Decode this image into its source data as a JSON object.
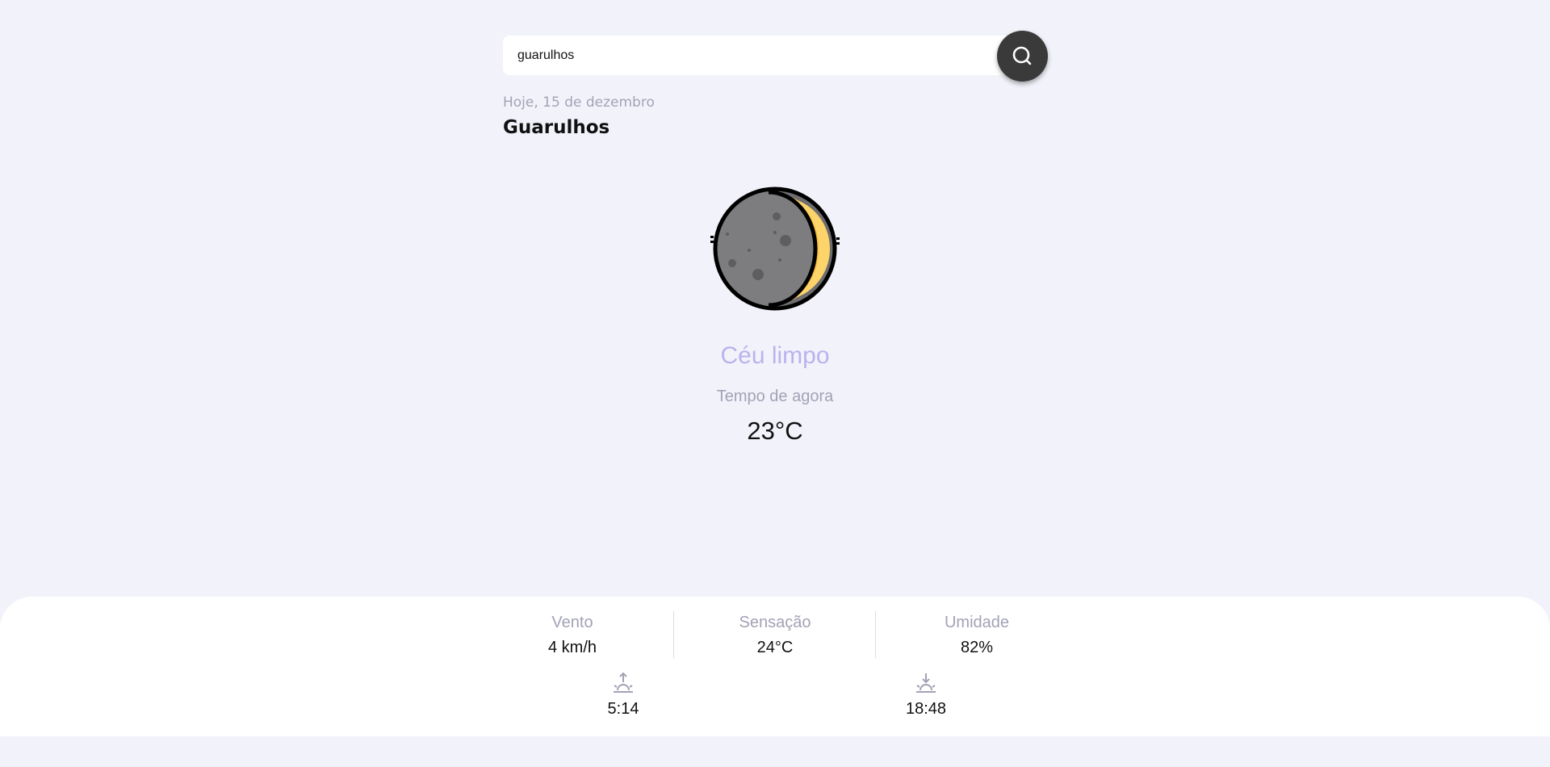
{
  "search": {
    "value": "guarulhos",
    "icon": "search-icon"
  },
  "location": {
    "date": "Hoje, 15 de dezembro",
    "city": "Guarulhos"
  },
  "current": {
    "icon": "crescent-moon-icon",
    "condition": "Céu limpo",
    "label": "Tempo de agora",
    "temperature": "23°C"
  },
  "details": {
    "wind": {
      "label": "Vento",
      "value": "4 km/h"
    },
    "feels_like": {
      "label": "Sensação",
      "value": "24°C"
    },
    "humidity": {
      "label": "Umidade",
      "value": "82%"
    },
    "sunrise": {
      "icon": "sunrise-icon",
      "time": "5:14"
    },
    "sunset": {
      "icon": "sunset-icon",
      "time": "18:48"
    }
  },
  "colors": {
    "background": "#f2f3fa",
    "condition": "#b9b2ee",
    "muted_text": "#a2a2b6",
    "search_button": "#3a3a3a",
    "moon_crescent": "#f7b73a",
    "moon_body": "#7a7a7a"
  }
}
